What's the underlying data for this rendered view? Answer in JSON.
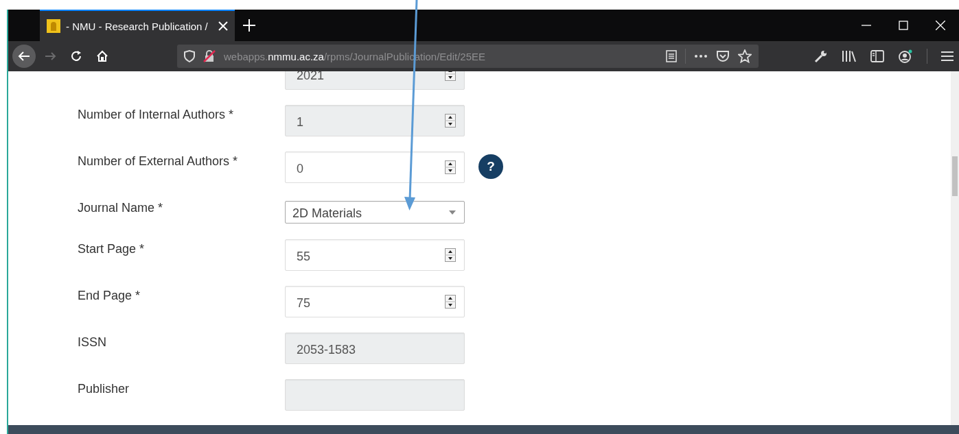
{
  "tab": {
    "title": "- NMU - Research Publication /",
    "selected": true
  },
  "url": [
    {
      "text": "webapps.",
      "emphasis": false
    },
    {
      "text": "nmmu.ac.za",
      "emphasis": true
    },
    {
      "text": "/rpms/JournalPublication/Edit/25EE",
      "emphasis": false
    }
  ],
  "fields": [
    {
      "kind": "spinner",
      "value": "2021",
      "disabled": true
    },
    {
      "kind": "spinner",
      "label": "Number of Internal Authors *",
      "value": "1",
      "disabled": true
    },
    {
      "kind": "spinner",
      "label": "Number of External Authors *",
      "value": "0",
      "disabled": false,
      "help": "?"
    },
    {
      "kind": "select",
      "label": "Journal Name *",
      "value": "2D Materials",
      "disabled": false
    },
    {
      "kind": "spinner",
      "label": "Start Page *",
      "value": "55",
      "disabled": false
    },
    {
      "kind": "spinner",
      "label": "End Page *",
      "value": "75",
      "disabled": false
    },
    {
      "kind": "text",
      "label": "ISSN",
      "value": "2053-1583",
      "disabled": true
    },
    {
      "kind": "text",
      "label": "Publisher",
      "disabled": true
    }
  ]
}
